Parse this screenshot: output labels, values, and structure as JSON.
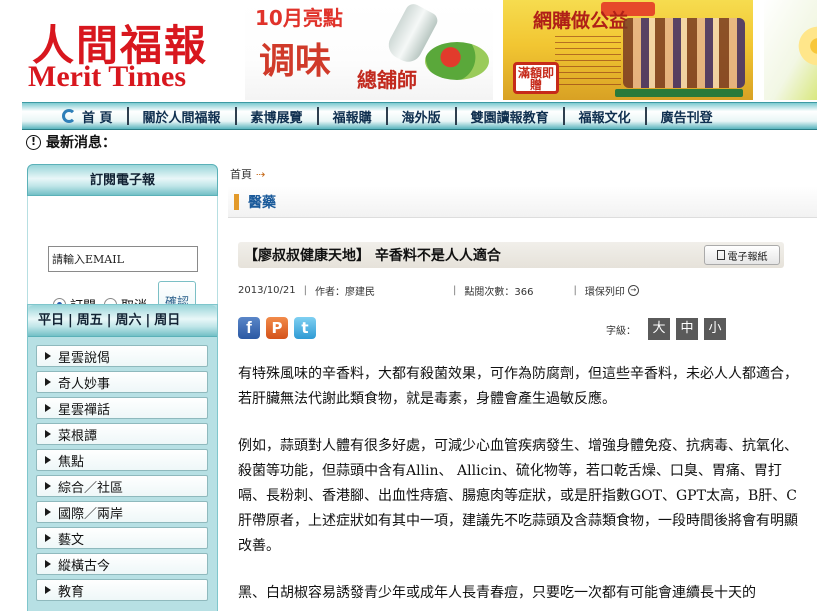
{
  "header": {
    "logo_cn": "人間福報",
    "logo_en": "Merit Times",
    "banner1": {
      "title": "10月亮點",
      "big": "调味",
      "shop": "總舖師"
    },
    "banner2": {
      "title": "網購做公益",
      "seal": "滿額即贈"
    }
  },
  "nav": {
    "items": [
      "首 頁",
      "關於人間福報",
      "素博展覽",
      "福報購",
      "海外版",
      "雙園讀報教育",
      "福報文化",
      "廣告刊登"
    ]
  },
  "latest": {
    "label": "最新消息：",
    "icon": "exclamation-icon"
  },
  "sidebar": {
    "epaper": {
      "title": "訂閱電子報",
      "email_value": "請輸入EMAIL",
      "subscribe": "訂閱",
      "cancel": "取消",
      "confirm": "確認"
    },
    "days": [
      "平日",
      "周五",
      "周六",
      "周日"
    ],
    "menu": [
      "星雲說偈",
      "奇人妙事",
      "星雲禪話",
      "菜根譚",
      "焦點",
      "綜合／社區",
      "國際／兩岸",
      "藝文",
      "縱橫古今",
      "教育"
    ]
  },
  "main": {
    "breadcrumb": "首頁",
    "section": "醫藥",
    "title": "【廖叔叔健康天地】 辛香料不是人人適合",
    "epaper_button": "電子報紙",
    "date": "2013/10/21",
    "author": "作者：廖建民",
    "views": "點閱次數：366",
    "print": "環保列印",
    "fontsize_label": "字級：",
    "fontsize": [
      "大",
      "中",
      "小"
    ],
    "paragraphs": [
      "有特殊風味的辛香料，大都有殺菌效果，可作為防腐劑，但這些辛香料，未必人人都適合，若肝臟無法代謝此類食物，就是毒素，身體會產生過敏反應。",
      "例如，蒜頭對人體有很多好處，可減少心血管疾病發生、增強身體免疫、抗病毒、抗氧化、殺菌等功能，但蒜頭中含有Allin、 Allicin、硫化物等，若口乾舌燥、口臭、胃痛、胃打嗝、長粉刺、香港腳、出血性痔瘡、腸瘜肉等症狀，或是肝指數GOT、GPT太高，B肝、C肝帶原者，上述症狀如有其中一項，建議先不吃蒜頭及含蒜類食物，一段時間後將會有明顯改善。",
      "黑、白胡椒容易誘發青少年或成年人長青春痘，只要吃一次都有可能會連續長十天的"
    ]
  },
  "colors": {
    "brand_red": "#d8171e",
    "nav_teal": "#59b4bd",
    "section_blue": "#1a5a9a"
  }
}
